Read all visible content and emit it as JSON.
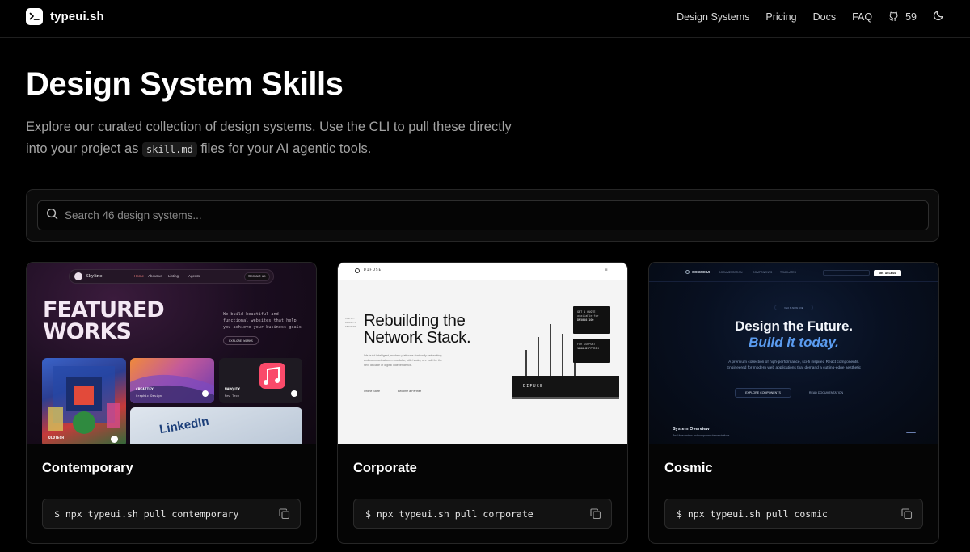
{
  "brand": {
    "name": "typeui.sh",
    "logo_icon": "terminal-icon"
  },
  "nav": {
    "links": [
      "Design Systems",
      "Pricing",
      "Docs",
      "FAQ"
    ],
    "github_stars": "59",
    "github_icon": "github-icon",
    "theme_icon": "moon-icon"
  },
  "hero": {
    "title": "Design System Skills",
    "desc_part1": "Explore our curated collection of design systems. Use the CLI to pull these directly into your project as",
    "desc_code": "skill.md",
    "desc_part2": "files for your AI agentic tools."
  },
  "search": {
    "placeholder": "Search 46 design systems...",
    "value": ""
  },
  "cards": [
    {
      "title": "Contemporary",
      "command": "$ npx typeui.sh pull contemporary",
      "preview": {
        "brand": "Skyline",
        "nav": [
          "Home",
          "About us",
          "Listing",
          "Agents",
          "Contact us"
        ],
        "headline": "FEATURED WORKS",
        "sub": "We build beautiful and functional websites that help you achieve your business goals",
        "button": "EXPLORE WORKS",
        "tiles": [
          "OLDTECH",
          "CREATIFY",
          "MARQUIX"
        ],
        "tile_subs": [
          "Graphic Design",
          "New Tech"
        ],
        "linkedin": "LinkedIn"
      }
    },
    {
      "title": "Corporate",
      "command": "$ npx typeui.sh pull corporate",
      "preview": {
        "brand": "DIFUSE",
        "side": [
          "CONTACT",
          "PRODUCTS",
          "SERVICES"
        ],
        "headline_1": "Rebuilding the",
        "headline_2": "Network Stack.",
        "body": "We build intelligent, modern platforms that unify networking and communication — modular, with hooks, are built for the next decade of digital independence.",
        "links": [
          "Online Store",
          "Become a Partner"
        ],
        "panel_1": [
          "GET A QUOTE",
          "available for",
          "DN5050-100"
        ],
        "panel_2": [
          "FOR SUPPORT",
          "1800-DIFFTECH"
        ],
        "device": "DIFUSE"
      }
    },
    {
      "title": "Cosmic",
      "command": "$ npx typeui.sh pull cosmic",
      "preview": {
        "brand": "COSMIC UI",
        "nav": [
          "DOCUMENTATION",
          "COMPONENTS",
          "TEMPLATES"
        ],
        "cta": "GET ACCESS",
        "pill": "V2.0 IS NOW LIVE",
        "headline_1": "Design the Future.",
        "headline_2": "Build it today.",
        "desc": "A premium collection of high-performance, sci-fi inspired React components. Engineered for modern web applications that demand a cutting-edge aesthetic",
        "btn_primary": "EXPLORE COMPONENTS",
        "btn_secondary": "READ DOCUMENTATION",
        "overview_title": "System Overview",
        "overview_sub": "Real-time metrics and component demonstrations."
      }
    }
  ],
  "copy_icon": "copy-icon"
}
